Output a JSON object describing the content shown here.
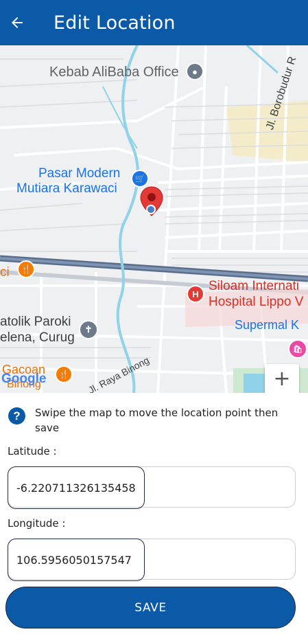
{
  "header": {
    "title": "Edit Location",
    "back_icon": "arrow-left-icon"
  },
  "map": {
    "labels": {
      "kebab": "Kebab AliBaba Office",
      "borobudur": "Jl. Borobudur R",
      "pasar_line1": "Pasar Modern",
      "pasar_line2": "Mutiara Karawaci",
      "ci": "ci",
      "siloam_line1": "Siloam Internati",
      "siloam_line2": "Hospital Lippo V",
      "super": "Supermal K",
      "katolik_line1": "atolik Paroki",
      "katolik_line2": "elena, Curug",
      "gacoan": "Gacoan",
      "binong": "Binong",
      "raya_binong": "Jl. Raya Binong",
      "google": "Google"
    },
    "zoom_in": "+",
    "zoom_out": "−"
  },
  "hint": {
    "text": "Swipe the map to move the location point then save",
    "icon": "help-circle-icon"
  },
  "form": {
    "latitude_label": "Latitude :",
    "latitude_value": "-6.220711326135458",
    "longitude_label": "Longitude :",
    "longitude_value": "106.5956050157547",
    "save_label": "SAVE"
  },
  "colors": {
    "primary": "#0b5aa8",
    "marker": "#e53935"
  }
}
